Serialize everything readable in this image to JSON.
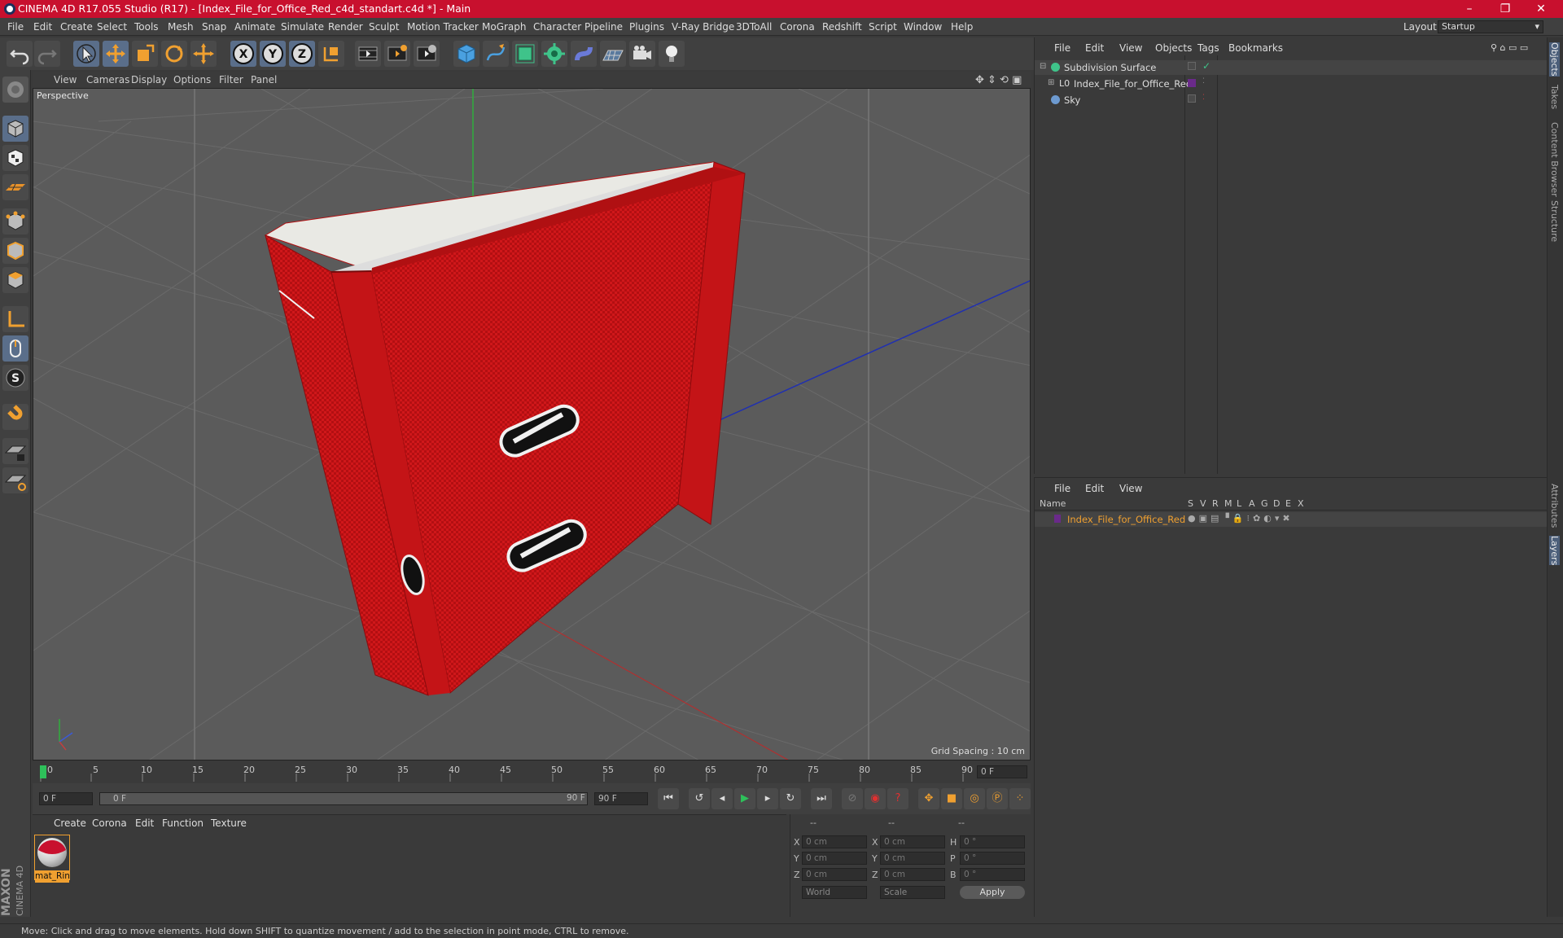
{
  "window": {
    "title": "CINEMA 4D R17.055 Studio (R17) - [Index_File_for_Office_Red_c4d_standart.c4d *] - Main"
  },
  "menu": [
    "File",
    "Edit",
    "Create",
    "Select",
    "Tools",
    "Mesh",
    "Snap",
    "Animate",
    "Simulate",
    "Render",
    "Sculpt",
    "Motion Tracker",
    "MoGraph",
    "Character",
    "Pipeline",
    "Plugins",
    "V-Ray Bridge",
    "3DToAll",
    "Corona",
    "Redshift",
    "Script",
    "Window",
    "Help"
  ],
  "layout": {
    "label": "Layout:",
    "value": "Startup"
  },
  "viewport": {
    "menu": [
      "View",
      "Cameras",
      "Display",
      "Options",
      "Filter",
      "Panel"
    ],
    "label": "Perspective",
    "grid_spacing": "Grid Spacing : 10 cm"
  },
  "timeline": {
    "ticks": [
      "0",
      "5",
      "10",
      "15",
      "20",
      "25",
      "30",
      "35",
      "40",
      "45",
      "50",
      "55",
      "60",
      "65",
      "70",
      "75",
      "80",
      "85",
      "90"
    ],
    "current_frame": "0 F"
  },
  "anim": {
    "start": "0 F",
    "range_start": "0 F",
    "range_end": "90 F",
    "end": "90 F"
  },
  "material": {
    "menu": [
      "Create",
      "Corona",
      "Edit",
      "Function",
      "Texture"
    ],
    "items": [
      {
        "name": "mat_Rin"
      }
    ]
  },
  "coords": {
    "header": [
      "--",
      "--",
      "--"
    ],
    "rows": [
      {
        "a": "X",
        "av": "0 cm",
        "b": "X",
        "bv": "0 cm",
        "c": "H",
        "cv": "0 °"
      },
      {
        "a": "Y",
        "av": "0 cm",
        "b": "Y",
        "bv": "0 cm",
        "c": "P",
        "cv": "0 °"
      },
      {
        "a": "Z",
        "av": "0 cm",
        "b": "Z",
        "bv": "0 cm",
        "c": "B",
        "cv": "0 °"
      }
    ],
    "world": "World",
    "scale": "Scale",
    "apply": "Apply"
  },
  "objects": {
    "menu": [
      "File",
      "Edit",
      "View",
      "Objects",
      "Tags",
      "Bookmarks"
    ],
    "items": [
      {
        "name": "Subdivision Surface"
      },
      {
        "name": "Index_File_for_Office_Red"
      },
      {
        "name": "Sky"
      }
    ]
  },
  "layers": {
    "menu": [
      "File",
      "Edit",
      "View"
    ],
    "columns": [
      "Name",
      "S",
      "V",
      "R",
      "M",
      "L",
      "A",
      "G",
      "D",
      "E",
      "X"
    ],
    "items": [
      {
        "name": "Index_File_for_Office_Red"
      }
    ]
  },
  "right_tabs": [
    "Objects",
    "Takes",
    "Content Browser",
    "Structure",
    "Attributes",
    "Layers"
  ],
  "status": "Move: Click and drag to move elements. Hold down SHIFT to quantize movement / add to the selection in point mode, CTRL to remove.",
  "brand": {
    "line1": "MAXON",
    "line2": "CINEMA 4D"
  },
  "colors": {
    "title_bar": "#c8102e",
    "binder": "#d0171a",
    "accent": "#f0a030"
  }
}
